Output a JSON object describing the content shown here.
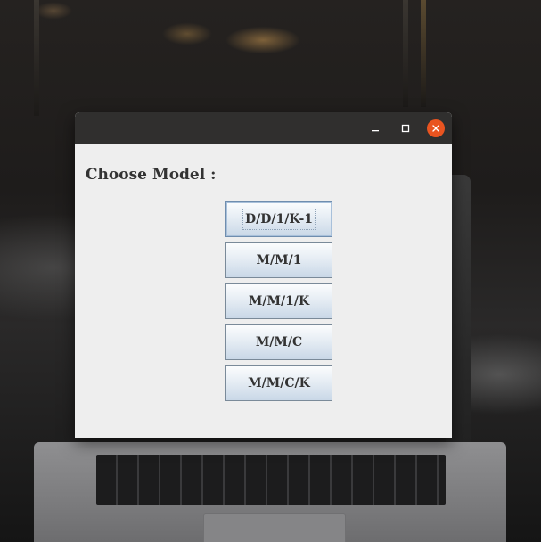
{
  "window": {
    "heading": "Choose Model :",
    "controls": {
      "minimize_icon": "minimize-icon",
      "maximize_icon": "maximize-icon",
      "close_icon": "close-icon",
      "close_color": "#e95420",
      "titlebar_color": "#302f2e"
    }
  },
  "models": [
    {
      "label": "D/D/1/K-1",
      "focused": true
    },
    {
      "label": "M/M/1",
      "focused": false
    },
    {
      "label": "M/M/1/K",
      "focused": false
    },
    {
      "label": "M/M/C",
      "focused": false
    },
    {
      "label": "M/M/C/K",
      "focused": false
    }
  ]
}
